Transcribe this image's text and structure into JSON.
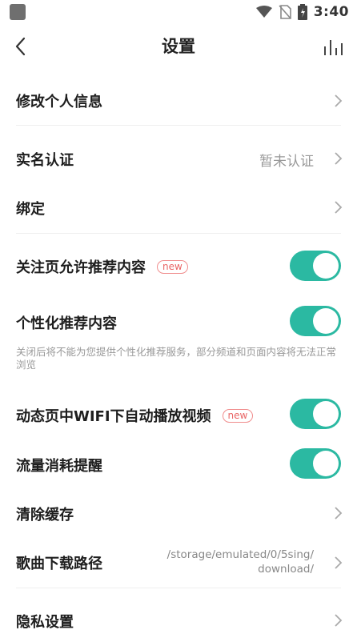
{
  "header": {
    "title": "设置"
  },
  "statusbar": {
    "time": "3:40"
  },
  "rows": {
    "profile": {
      "label": "修改个人信息"
    },
    "realname": {
      "label": "实名认证",
      "value": "暂未认证"
    },
    "bind": {
      "label": "绑定"
    },
    "follow_recommend": {
      "label": "关注页允许推荐内容",
      "badge": "new",
      "enabled": true
    },
    "personalized": {
      "label": "个性化推荐内容",
      "enabled": true,
      "note": "关闭后将不能为您提供个性化推荐服务，部分频道和页面内容将无法正常浏览"
    },
    "autoplay": {
      "label": "动态页中WIFI下自动播放视频",
      "badge": "new",
      "enabled": true
    },
    "data_alert": {
      "label": "流量消耗提醒",
      "enabled": true
    },
    "clear_cache": {
      "label": "清除缓存"
    },
    "download_path": {
      "label": "歌曲下载路径",
      "value_line1": "/storage/emulated/0/5sing/",
      "value_line2": "download/"
    },
    "privacy": {
      "label": "隐私设置"
    }
  },
  "colors": {
    "toggle_on": "#2bb9a2",
    "badge": "#e96565",
    "muted_text": "#999999"
  }
}
